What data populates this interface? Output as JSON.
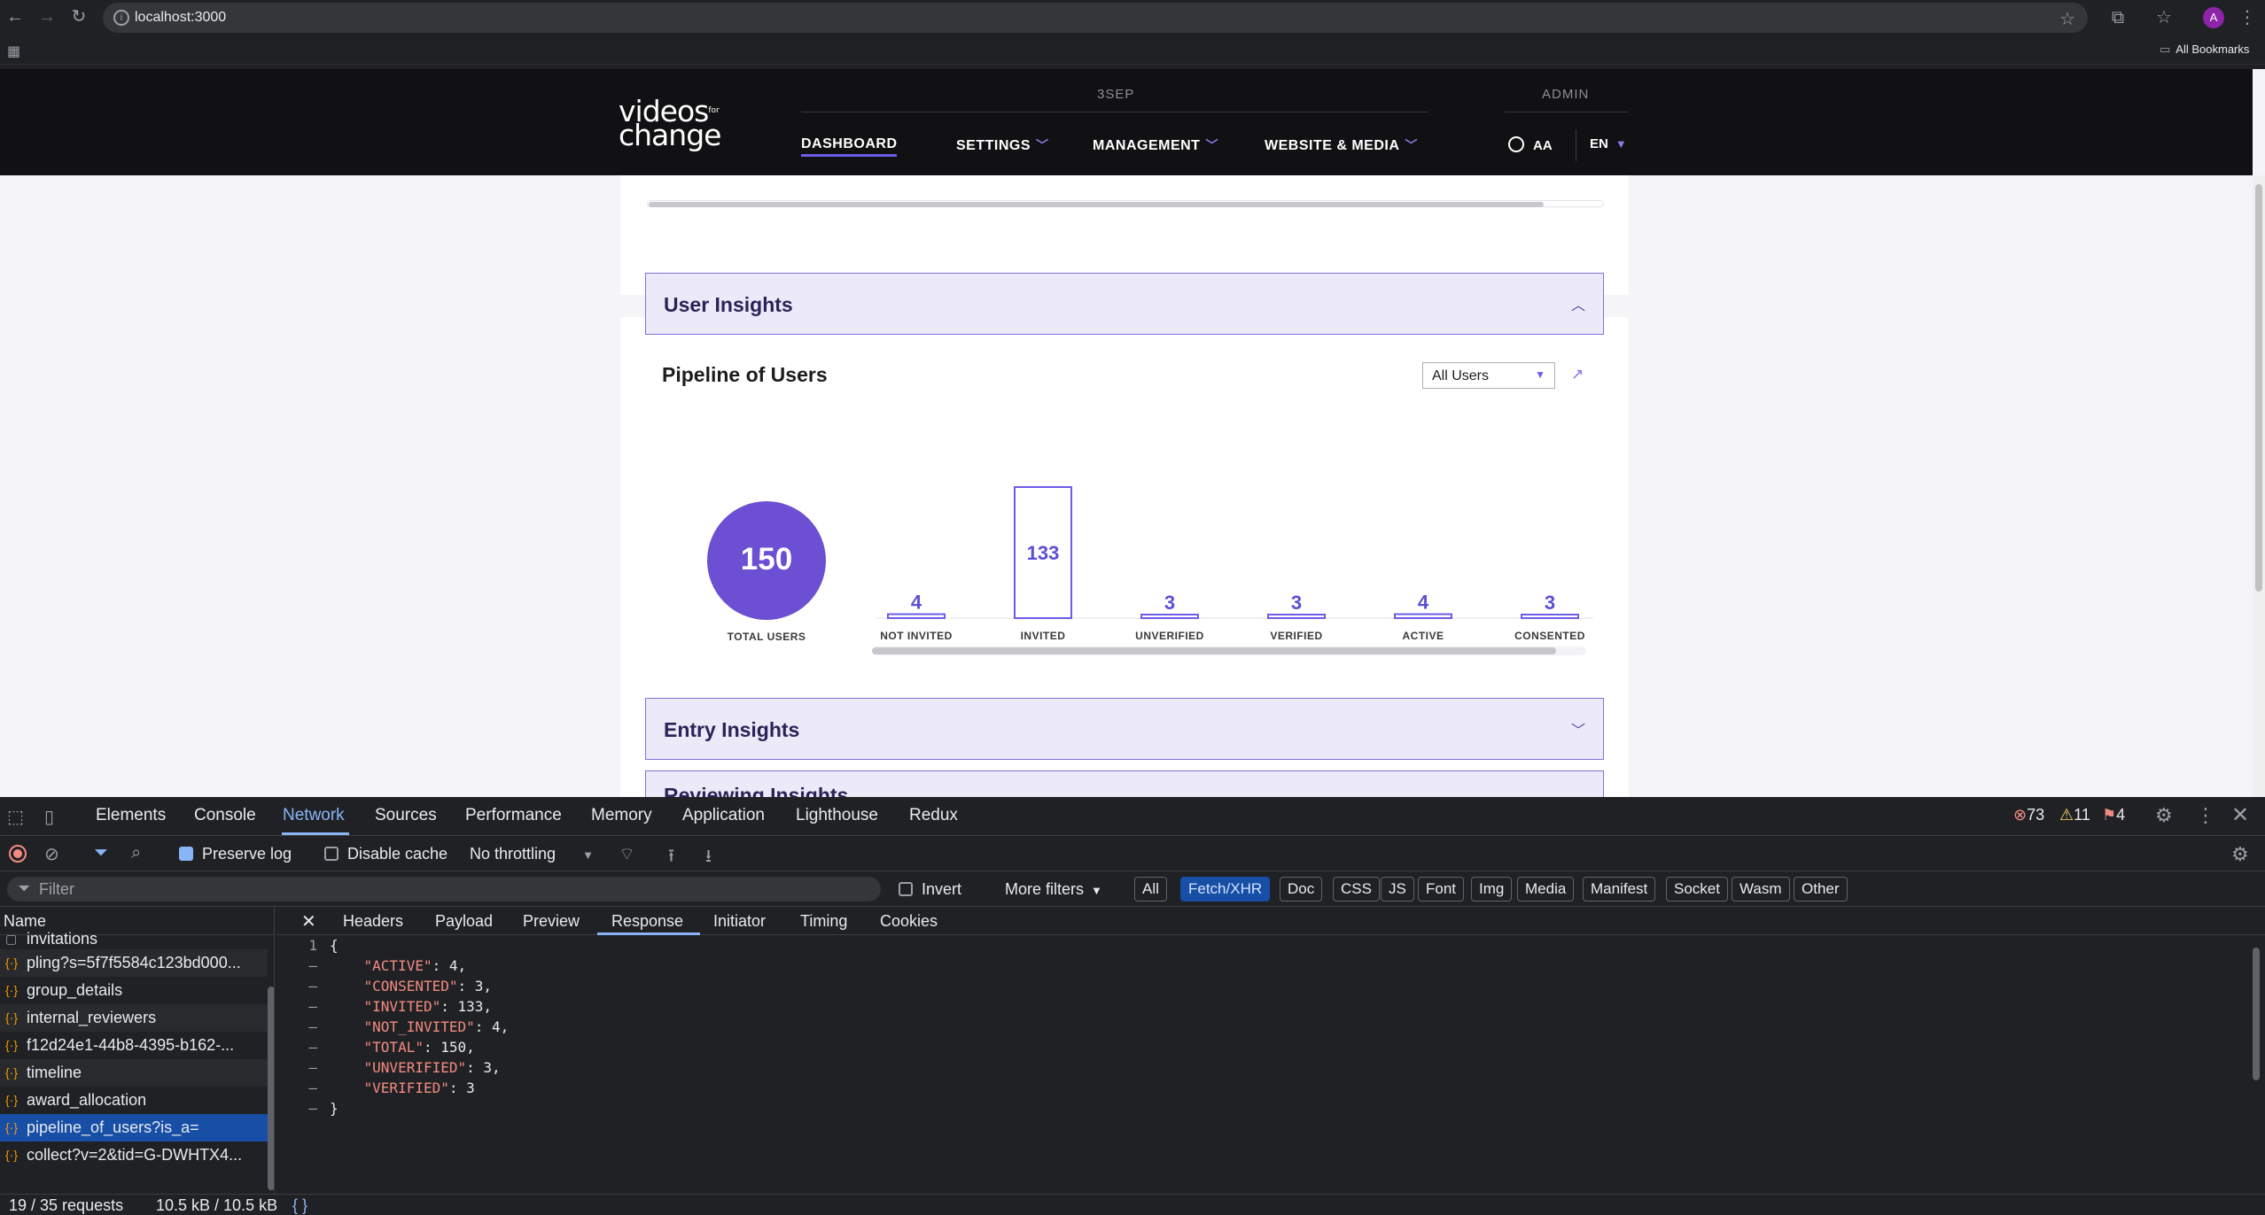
{
  "browser": {
    "url": "localhost:3000",
    "all_bookmarks": "All Bookmarks",
    "profile_initial": "A"
  },
  "site": {
    "logo_top": "videos",
    "logo_for": "for",
    "logo_bottom": "change",
    "event_label": "3SEP",
    "admin_label": "ADMIN",
    "nav": [
      {
        "label": "DASHBOARD",
        "active": true
      },
      {
        "label": "SETTINGS"
      },
      {
        "label": "MANAGEMENT"
      },
      {
        "label": "WEBSITE & MEDIA"
      }
    ],
    "user_initials": "AA",
    "language": "EN"
  },
  "insights": {
    "user_insights_title": "User Insights",
    "pipeline_title": "Pipeline of Users",
    "filter_value": "All Users",
    "total_value": "150",
    "total_label": "TOTAL USERS",
    "entry_insights_title": "Entry Insights",
    "partial_title": "Reviewing Insights"
  },
  "chart_data": {
    "type": "bar",
    "categories": [
      "NOT INVITED",
      "INVITED",
      "UNVERIFIED",
      "VERIFIED",
      "ACTIVE",
      "CONSENTED"
    ],
    "values": [
      4,
      133,
      3,
      3,
      4,
      3
    ],
    "ylim": [
      0,
      133
    ],
    "colors": {
      "bar_stroke": "#6c5ce7",
      "label": "#5b4fd6"
    }
  },
  "devtools": {
    "tabs": [
      "Elements",
      "Console",
      "Network",
      "Sources",
      "Performance",
      "Memory",
      "Application",
      "Lighthouse",
      "Redux"
    ],
    "errors": "73",
    "warnings": "11",
    "issues": "4",
    "preserve_log": "Preserve log",
    "disable_cache": "Disable cache",
    "throttling": "No throttling",
    "filter_placeholder": "Filter",
    "invert": "Invert",
    "more_filters": "More filters",
    "types": [
      "All",
      "Fetch/XHR",
      "Doc",
      "CSS",
      "JS",
      "Font",
      "Img",
      "Media",
      "Manifest",
      "Socket",
      "Wasm",
      "Other"
    ],
    "name_header": "Name",
    "requests": [
      "invitations",
      "pling?s=5f7f5584c123bd000...",
      "group_details",
      "internal_reviewers",
      "f12d24e1-44b8-4395-b162-...",
      "timeline",
      "award_allocation",
      "pipeline_of_users?is_a=",
      "collect?v=2&tid=G-DWHTX4..."
    ],
    "detail_tabs": [
      "Headers",
      "Payload",
      "Preview",
      "Response",
      "Initiator",
      "Timing",
      "Cookies"
    ],
    "response_lines": [
      {
        "gutter": "1",
        "text": "{"
      },
      {
        "gutter": "–",
        "key": "\"ACTIVE\"",
        "rest": ": 4,"
      },
      {
        "gutter": "–",
        "key": "\"CONSENTED\"",
        "rest": ": 3,"
      },
      {
        "gutter": "–",
        "key": "\"INVITED\"",
        "rest": ": 133,"
      },
      {
        "gutter": "–",
        "key": "\"NOT_INVITED\"",
        "rest": ": 4,"
      },
      {
        "gutter": "–",
        "key": "\"TOTAL\"",
        "rest": ": 150,"
      },
      {
        "gutter": "–",
        "key": "\"UNVERIFIED\"",
        "rest": ": 3,"
      },
      {
        "gutter": "–",
        "key": "\"VERIFIED\"",
        "rest": ": 3"
      },
      {
        "gutter": "–",
        "text": "}"
      }
    ],
    "status_requests": "19 / 35 requests",
    "status_size": "10.5 kB / 10.5 kB",
    "status_braces": "{ }"
  }
}
